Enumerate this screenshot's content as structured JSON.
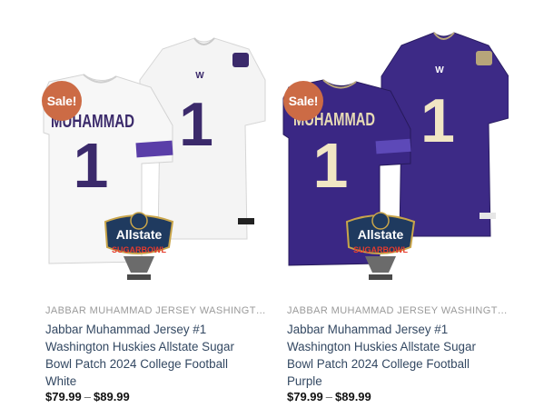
{
  "products": [
    {
      "badge": "Sale!",
      "category": "JABBAR MUHAMMAD JERSEY WASHINGTO...",
      "title": "Jabbar Muhammad Jersey #1 Washington Huskies Allstate Sugar Bowl Patch 2024 College Football White",
      "price_low": "$79.99",
      "price_sep": "–",
      "price_high": "$89.99",
      "jersey_name": "MUHAMMAD",
      "jersey_number": "1",
      "logo_letter": "W",
      "patch_top": "Allstate",
      "patch_bottom": "SUGARBOWL",
      "colors": {
        "jersey": "#f4f4f4",
        "shade": "#e2e2e2",
        "numeral": "#3b2a6b",
        "trim": "#4b2e83"
      }
    },
    {
      "badge": "Sale!",
      "category": "JABBAR MUHAMMAD JERSEY WASHINGTO...",
      "title": "Jabbar Muhammad Jersey #1 Washington Huskies Allstate Sugar Bowl Patch 2024 College Football Purple",
      "price_low": "$79.99",
      "price_sep": "–",
      "price_high": "$89.99",
      "jersey_name": "MUHAMMAD",
      "jersey_number": "1",
      "logo_letter": "W",
      "patch_top": "Allstate",
      "patch_bottom": "SUGARBOWL",
      "colors": {
        "jersey": "#3d2a86",
        "shade": "#2f2070",
        "numeral": "#f1e6c4",
        "trim": "#b7a57a"
      }
    }
  ]
}
